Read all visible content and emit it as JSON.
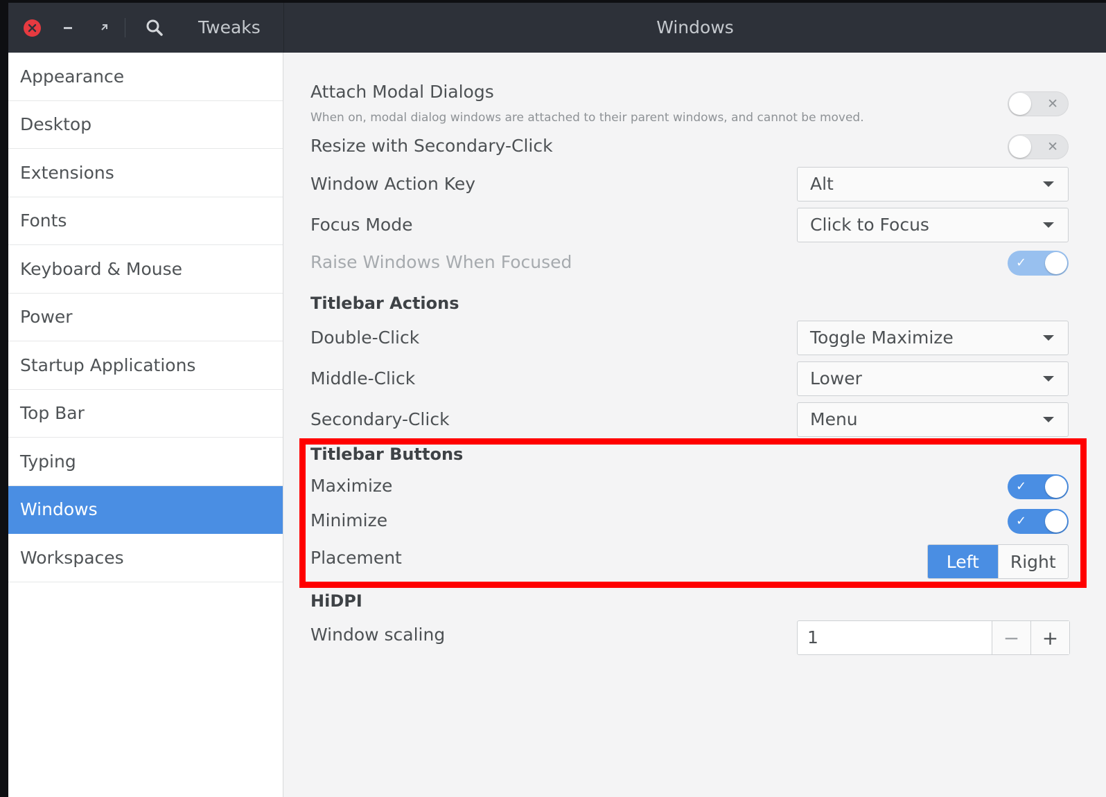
{
  "window": {
    "app_title": "Tweaks",
    "page_title": "Windows"
  },
  "sidebar": {
    "items": [
      {
        "label": "Appearance"
      },
      {
        "label": "Desktop"
      },
      {
        "label": "Extensions"
      },
      {
        "label": "Fonts"
      },
      {
        "label": "Keyboard & Mouse"
      },
      {
        "label": "Power"
      },
      {
        "label": "Startup Applications"
      },
      {
        "label": "Top Bar"
      },
      {
        "label": "Typing"
      },
      {
        "label": "Windows",
        "selected": true
      },
      {
        "label": "Workspaces"
      }
    ]
  },
  "settings": {
    "attach_modal": {
      "label": "Attach Modal Dialogs",
      "description": "When on, modal dialog windows are attached to their parent windows, and cannot be moved.",
      "state": "off",
      "mark": "✕"
    },
    "resize_secondary": {
      "label": "Resize with Secondary-Click",
      "state": "off",
      "mark": "✕"
    },
    "window_action_key": {
      "label": "Window Action Key",
      "value": "Alt"
    },
    "focus_mode": {
      "label": "Focus Mode",
      "value": "Click to Focus"
    },
    "raise_windows": {
      "label": "Raise Windows When Focused",
      "state": "on",
      "disabled": true,
      "mark": "✓"
    }
  },
  "titlebar_actions": {
    "heading": "Titlebar Actions",
    "double_click": {
      "label": "Double-Click",
      "value": "Toggle Maximize"
    },
    "middle_click": {
      "label": "Middle-Click",
      "value": "Lower"
    },
    "secondary_click": {
      "label": "Secondary-Click",
      "value": "Menu"
    }
  },
  "titlebar_buttons": {
    "heading": "Titlebar Buttons",
    "maximize": {
      "label": "Maximize",
      "state": "on",
      "mark": "✓"
    },
    "minimize": {
      "label": "Minimize",
      "state": "on",
      "mark": "✓"
    },
    "placement": {
      "label": "Placement",
      "options": [
        "Left",
        "Right"
      ],
      "selected": "Left"
    }
  },
  "hidpi": {
    "heading": "HiDPI",
    "window_scaling": {
      "label": "Window scaling",
      "value": "1",
      "minus": "−",
      "plus": "+"
    }
  },
  "colors": {
    "accent": "#4a8ee3",
    "headerbar": "#2d3139",
    "close": "#e63a40",
    "highlight": "#ff0000"
  },
  "icons": {
    "close": "close-icon",
    "minimize": "minimize-icon",
    "restore": "restore-icon",
    "search": "search-icon",
    "dropdown": "chevron-down-icon"
  }
}
